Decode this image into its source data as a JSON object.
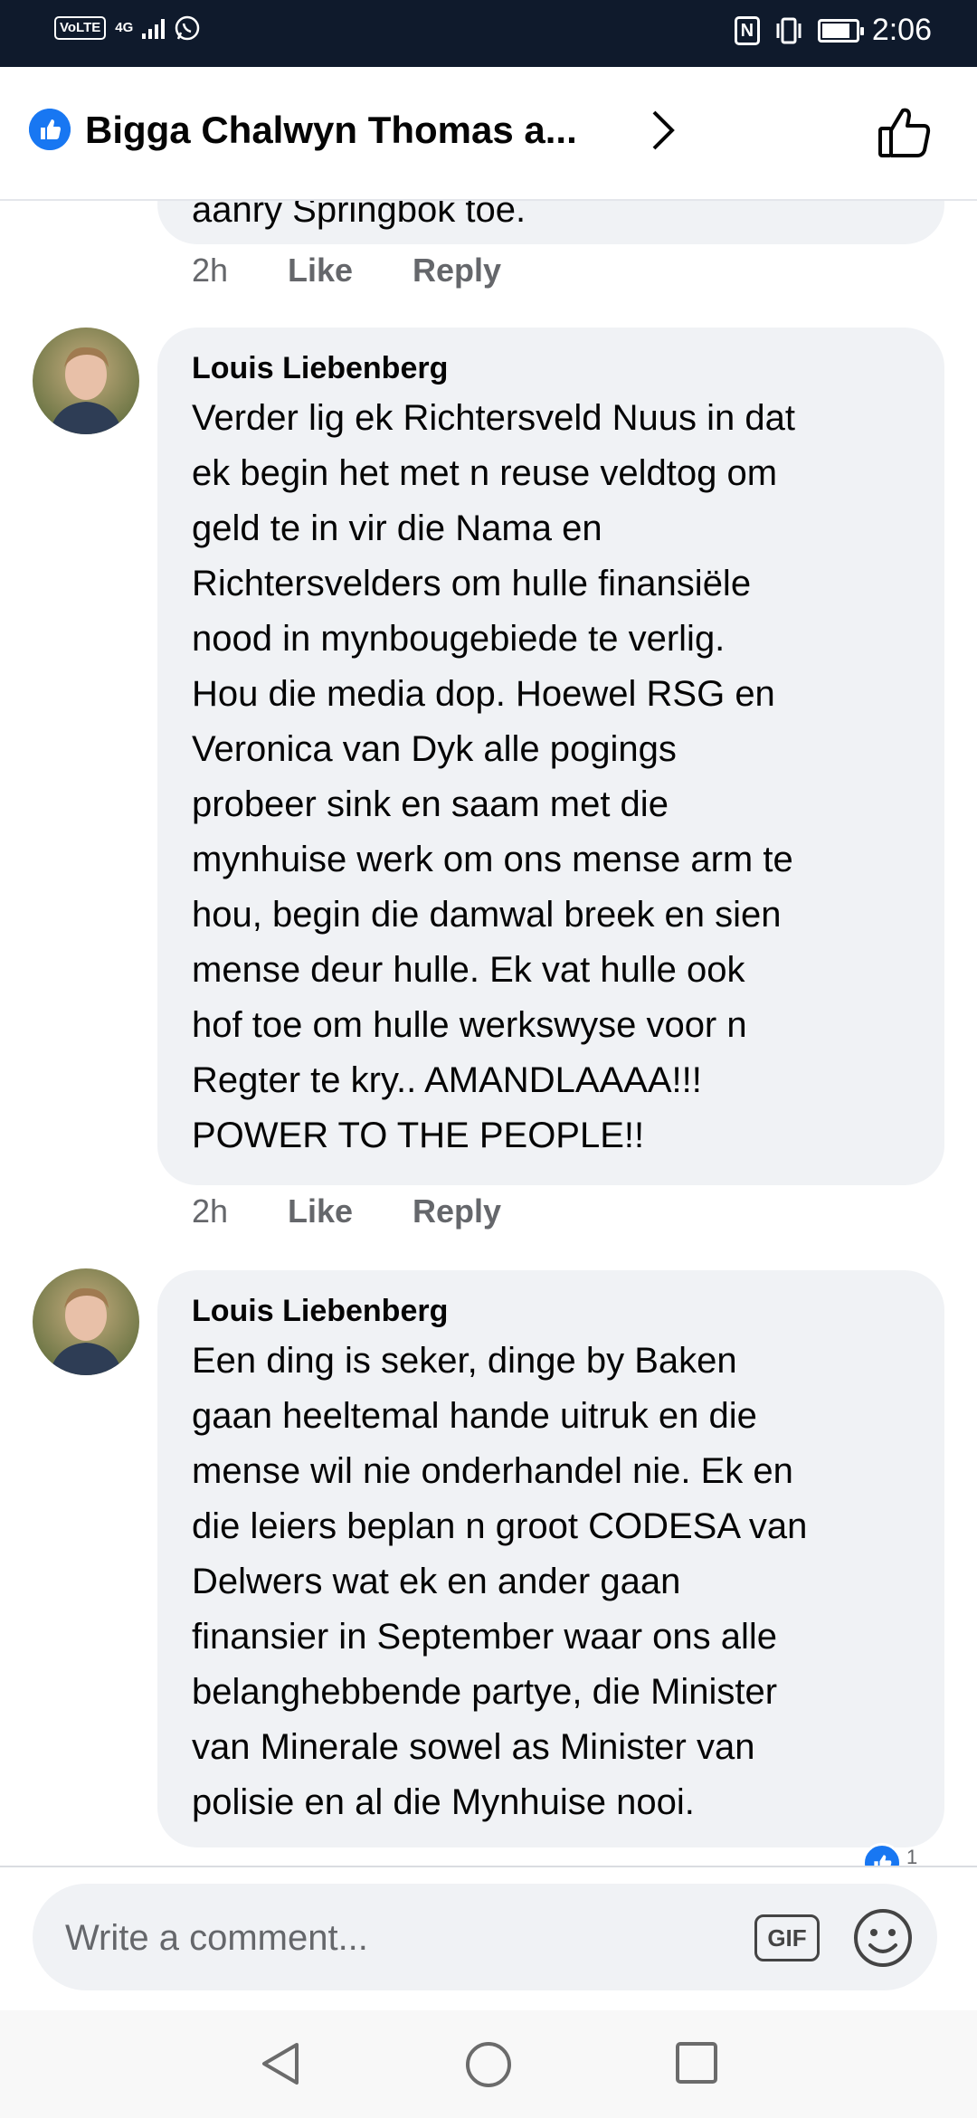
{
  "status_bar": {
    "volte": "VoLTE",
    "network": "4G",
    "time": "2:06",
    "battery_level": 0.85
  },
  "header": {
    "title": "Bigga Chalwyn Thomas a..."
  },
  "feed": {
    "previous_comment": {
      "text_fragment": "aanry Springbok toe.",
      "age": "2h",
      "like_label": "Like",
      "reply_label": "Reply"
    },
    "comments": [
      {
        "author": "Louis Liebenberg",
        "text": "Verder lig ek Richtersveld Nuus in dat\nek begin het met n reuse veldtog om\ngeld te in vir die Nama en\nRichtersvelders om hulle finansiële\nnood in mynbougebiede te verlig.\nHou die media dop. Hoewel RSG en\nVeronica van Dyk alle pogings\nprobeer sink en saam met die\nmynhuise werk om ons mense arm te\nhou, begin die damwal breek en sien\nmense deur hulle. Ek vat hulle ook\nhof toe om hulle werkswyse voor n\nRegter te kry.. AMANDLAAAA!!!\nPOWER TO THE PEOPLE!!",
        "age": "2h",
        "like_label": "Like",
        "reply_label": "Reply"
      },
      {
        "author": "Louis Liebenberg",
        "text": "Een ding is seker, dinge by Baken\ngaan heeltemal hande uitruk en die\nmense wil nie onderhandel nie. Ek en\ndie leiers beplan n groot CODESA van\nDelwers wat ek en ander gaan\nfinansier in September waar ons alle\nbelanghebbende partye, die Minister\nvan Minerale sowel as Minister van\npolisie en al die Mynhuise nooi.",
        "reaction_count": "1"
      }
    ]
  },
  "composer": {
    "placeholder": "Write a comment...",
    "gif_label": "GIF"
  },
  "colors": {
    "status_bar_bg": "#0f1a2c",
    "bubble_bg": "#f0f2f5",
    "facebook_blue": "#1877f2",
    "secondary_text": "#65676b"
  },
  "icons": [
    "like-badge-icon",
    "chevron-right-icon",
    "thumbs-up-outline-icon",
    "gif-icon",
    "emoji-icon",
    "nav-back-icon",
    "nav-home-icon",
    "nav-recents-icon"
  ]
}
